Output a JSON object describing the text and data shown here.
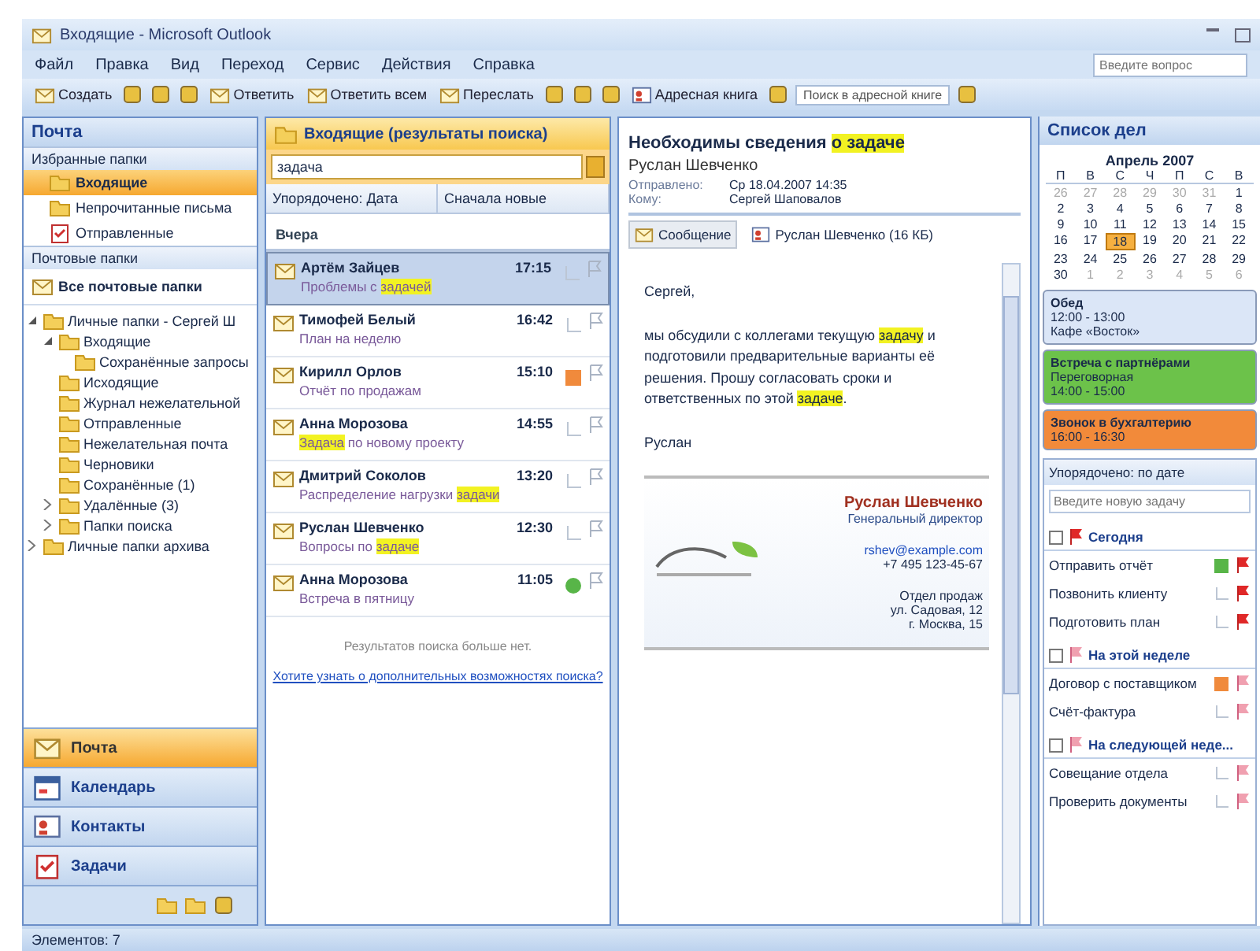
{
  "window": {
    "title": "Входящие - Microsoft Outlook"
  },
  "menu": [
    "Файл",
    "Правка",
    "Вид",
    "Переход",
    "Сервис",
    "Действия",
    "Справка"
  ],
  "help_search": {
    "placeholder": "Введите вопрос"
  },
  "toolbar": [
    {
      "kind": "new",
      "label": "Создать"
    },
    {
      "kind": "icon"
    },
    {
      "kind": "icon"
    },
    {
      "kind": "icon"
    },
    {
      "kind": "reply",
      "label": "Ответить"
    },
    {
      "kind": "reply",
      "label": "Ответить всем"
    },
    {
      "kind": "forward",
      "label": "Переслать"
    },
    {
      "kind": "icon"
    },
    {
      "kind": "icon"
    },
    {
      "kind": "icon"
    },
    {
      "kind": "find",
      "label": "Адресная книга"
    },
    {
      "kind": "icon"
    },
    {
      "kind": "field",
      "label": "Поиск в адресной книге"
    },
    {
      "kind": "icon"
    }
  ],
  "nav": {
    "title": "Почта",
    "favorites_title": "Избранные папки",
    "favorites": [
      {
        "label": "Входящие",
        "selected": true
      },
      {
        "label": "Непрочитанные письма",
        "selected": false
      },
      {
        "label": "Отправленные",
        "selected": false
      }
    ],
    "folders_title": "Почтовые папки",
    "folders_view": "Все почтовые папки",
    "tree": [
      {
        "label": "Личные папки - Сергей Ш",
        "expanded": true,
        "children": [
          {
            "label": "Входящие",
            "expanded": true,
            "children": [
              {
                "label": "Сохранённые запросы"
              }
            ]
          },
          {
            "label": "Исходящие"
          },
          {
            "label": "Журнал нежелательной"
          },
          {
            "label": "Отправленные"
          },
          {
            "label": "Нежелательная почта"
          },
          {
            "label": "Черновики"
          },
          {
            "label": "Сохранённые (1)"
          },
          {
            "label": "Удалённые (3)",
            "expanded": false
          },
          {
            "label": "Папки поиска",
            "expanded": false
          }
        ]
      },
      {
        "label": "Личные папки архива",
        "expanded": false
      }
    ],
    "buttons": [
      {
        "label": "Почта",
        "selected": true
      },
      {
        "label": "Календарь",
        "selected": false
      },
      {
        "label": "Контакты",
        "selected": false
      },
      {
        "label": "Задачи",
        "selected": false
      }
    ]
  },
  "list": {
    "title": "Входящие (результаты поиска)",
    "search": {
      "value": "задача"
    },
    "sort": "Упорядочено: Дата",
    "order": "Сначала новые",
    "group": "Вчера",
    "messages": [
      {
        "sender": "Артём Зайцев",
        "time": "17:15",
        "selected": true,
        "subject": [
          {
            "text": "Проблемы с ",
            "highlight": false
          },
          {
            "text": "задачей",
            "highlight": true
          }
        ]
      },
      {
        "sender": "Тимофей Белый",
        "time": "16:42",
        "selected": false,
        "subject": [
          {
            "text": "План на неделю",
            "highlight": false
          }
        ]
      },
      {
        "sender": "Кирилл Орлов",
        "time": "15:10",
        "selected": false,
        "color": "#f08a3c",
        "subject": [
          {
            "text": "Отчёт по продажам",
            "highlight": false
          }
        ]
      },
      {
        "sender": "Анна Морозова",
        "time": "14:55",
        "selected": false,
        "subject": [
          {
            "text": "Задача",
            "highlight": true
          },
          {
            "text": " по новому проекту",
            "highlight": false
          }
        ]
      },
      {
        "sender": "Дмитрий Соколов",
        "time": "13:20",
        "selected": false,
        "subject": [
          {
            "text": "Распределение нагрузки ",
            "highlight": false
          },
          {
            "text": "задачи",
            "highlight": true
          }
        ]
      },
      {
        "sender": "Руслан Шевченко",
        "time": "12:30",
        "selected": false,
        "subject": [
          {
            "text": "Вопросы по ",
            "highlight": false
          },
          {
            "text": "задаче",
            "highlight": true
          }
        ]
      },
      {
        "sender": "Анна Морозова",
        "time": "11:05",
        "selected": false,
        "color": "#58b548",
        "subject": [
          {
            "text": "Встреча в пятницу",
            "highlight": false
          }
        ]
      }
    ],
    "no_more": "Результатов поиска больше нет.",
    "more_link": "Хотите узнать о дополнительных возможностях поиска?"
  },
  "reading": {
    "subject": [
      {
        "text": "Необходимы сведения ",
        "highlight": false
      },
      {
        "text": "о задаче",
        "highlight": true
      }
    ],
    "sender": "Руслан Шевченко",
    "meta": [
      {
        "label": "Отправлено:",
        "value": "Ср 18.04.2007 14:35"
      },
      {
        "label": "Кому:",
        "value": "Сергей Шаповалов"
      }
    ],
    "attachments": [
      {
        "label": "Сообщение",
        "selected": true
      },
      {
        "label": "Руслан Шевченко (16 КБ)",
        "selected": false
      }
    ],
    "body": [
      [
        {
          "text": "Сергей,",
          "highlight": false
        }
      ],
      [
        {
          "text": "мы обсудили с коллегами текущую ",
          "highlight": false
        },
        {
          "text": "задачу",
          "highlight": true
        },
        {
          "text": " и подготовили предварительные варианты её решения. Прошу согласовать сроки и ответственных по этой ",
          "highlight": false
        },
        {
          "text": "задаче",
          "highlight": true
        },
        {
          "text": ".",
          "highlight": false
        }
      ],
      [
        {
          "text": "Руслан",
          "highlight": false
        }
      ]
    ],
    "card": {
      "name": "Руслан Шевченко",
      "title": "Генеральный директор",
      "email": "rshev@example.com",
      "phone": "+7 495 123-45-67",
      "address": [
        "Отдел продаж",
        "ул. Садовая, 12",
        "г. Москва, 15"
      ]
    }
  },
  "todo": {
    "title": "Список дел",
    "month": "Апрель 2007",
    "weekdays": [
      "П",
      "В",
      "С",
      "Ч",
      "П",
      "С",
      "В"
    ],
    "days": [
      {
        "d": "26",
        "other": true,
        "selected": false
      },
      {
        "d": "27",
        "other": true,
        "selected": false
      },
      {
        "d": "28",
        "other": true,
        "selected": false
      },
      {
        "d": "29",
        "other": true,
        "selected": false
      },
      {
        "d": "30",
        "other": true,
        "selected": false
      },
      {
        "d": "31",
        "other": true,
        "selected": false
      },
      {
        "d": "1",
        "other": false,
        "selected": false
      },
      {
        "d": "2",
        "other": false,
        "selected": false
      },
      {
        "d": "3",
        "other": false,
        "selected": false
      },
      {
        "d": "4",
        "other": false,
        "selected": false
      },
      {
        "d": "5",
        "other": false,
        "selected": false
      },
      {
        "d": "6",
        "other": false,
        "selected": false
      },
      {
        "d": "7",
        "other": false,
        "selected": false
      },
      {
        "d": "8",
        "other": false,
        "selected": false
      },
      {
        "d": "9",
        "other": false,
        "selected": false
      },
      {
        "d": "10",
        "other": false,
        "selected": false
      },
      {
        "d": "11",
        "other": false,
        "selected": false
      },
      {
        "d": "12",
        "other": false,
        "selected": false
      },
      {
        "d": "13",
        "other": false,
        "selected": false
      },
      {
        "d": "14",
        "other": false,
        "selected": false
      },
      {
        "d": "15",
        "other": false,
        "selected": false
      },
      {
        "d": "16",
        "other": false,
        "selected": false
      },
      {
        "d": "17",
        "other": false,
        "selected": false
      },
      {
        "d": "18",
        "other": false,
        "selected": true
      },
      {
        "d": "19",
        "other": false,
        "selected": false
      },
      {
        "d": "20",
        "other": false,
        "selected": false
      },
      {
        "d": "21",
        "other": false,
        "selected": false
      },
      {
        "d": "22",
        "other": false,
        "selected": false
      },
      {
        "d": "23",
        "other": false,
        "selected": false
      },
      {
        "d": "24",
        "other": false,
        "selected": false
      },
      {
        "d": "25",
        "other": false,
        "selected": false
      },
      {
        "d": "26",
        "other": false,
        "selected": false
      },
      {
        "d": "27",
        "other": false,
        "selected": false
      },
      {
        "d": "28",
        "other": false,
        "selected": false
      },
      {
        "d": "29",
        "other": false,
        "selected": false
      },
      {
        "d": "30",
        "other": false,
        "selected": false
      },
      {
        "d": "1",
        "other": true,
        "selected": false
      },
      {
        "d": "2",
        "other": true,
        "selected": false
      },
      {
        "d": "3",
        "other": true,
        "selected": false
      },
      {
        "d": "4",
        "other": true,
        "selected": false
      },
      {
        "d": "5",
        "other": true,
        "selected": false
      },
      {
        "d": "6",
        "other": true,
        "selected": false
      }
    ],
    "appointments": [
      {
        "lines": [
          "Обед",
          "12:00 - 13:00",
          "Кафе «Восток»"
        ],
        "color": "#dbe6f7"
      },
      {
        "lines": [
          "Встреча с партнёрами",
          "Переговорная",
          "14:00 - 15:00"
        ],
        "color": "#6cc24a"
      },
      {
        "lines": [
          "Звонок в бухгалтерию",
          "16:00 - 16:30"
        ],
        "color": "#f28a3a"
      }
    ],
    "tasks_sort": "Упорядочено: по дате",
    "new_task": {
      "placeholder": "Введите новую задачу"
    },
    "groups": [
      {
        "label": "Сегодня",
        "tasks": [
          {
            "title": "Отправить отчёт",
            "color": "#58b548"
          },
          {
            "title": "Позвонить клиенту"
          },
          {
            "title": "Подготовить план"
          }
        ]
      },
      {
        "label": "На этой неделе",
        "tasks": [
          {
            "title": "Договор с поставщиком",
            "color": "#f08a3c"
          },
          {
            "title": "Счёт-фактура"
          }
        ]
      },
      {
        "label": "На следующей неде...",
        "tasks": [
          {
            "title": "Совещание отдела"
          },
          {
            "title": "Проверить документы"
          }
        ]
      }
    ]
  },
  "status_bar": "Элементов: 7"
}
